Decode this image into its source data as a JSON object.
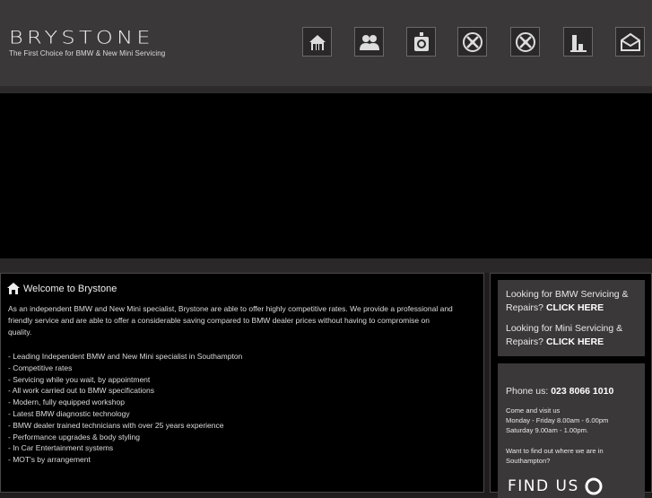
{
  "header": {
    "brand": "BRYSTONE",
    "tagline": "The First Choice for BMW & New Mini Servicing"
  },
  "nav": [
    {
      "icon": "home-icon"
    },
    {
      "icon": "people-icon"
    },
    {
      "icon": "camera-icon"
    },
    {
      "icon": "tools-icon"
    },
    {
      "icon": "tools-icon"
    },
    {
      "icon": "bar-chart-icon"
    },
    {
      "icon": "envelope-icon"
    }
  ],
  "main": {
    "welcome_title": "Welcome to Brystone",
    "intro_lines": [
      "As an independent BMW and New Mini specialist, Brystone are able to offer highly competitive rates. We provide a professional and",
      "friendly service and are able to offer a considerable saving compared to BMW dealer prices without having to compromise on",
      "quality."
    ],
    "features": [
      "- Leading Independent BMW and New Mini specialist in Southampton",
      "- Competitive rates",
      "- Servicing while you wait, by appointment",
      "- All work carried out to BMW specifications",
      "- Modern, fully equipped workshop",
      "- Latest BMW diagnostic technology",
      "- BMW dealer trained technicians with over 25 years experience",
      "- Performance upgrades & body styling",
      "- In Car Entertainment systems",
      "- MOT's by arrangement"
    ]
  },
  "sidebar": {
    "bmw_lead": "Looking for BMW Servicing &",
    "bmw_tail": "Repairs?",
    "bmw_cta": "CLICK HERE",
    "mini_lead": "Looking for Mini Servicing &",
    "mini_tail": "Repairs?",
    "mini_cta": "CLICK HERE",
    "phone_label": "Phone us:",
    "phone_number": "023 8066 1010",
    "visit_title": "Come and visit us",
    "visit_weekday": "Monday - Friday 8.00am - 6.00pm",
    "visit_saturday": "Saturday 9.00am - 1.00pm.",
    "where_line1": "Want to find out where we are in",
    "where_line2": "Southampton?",
    "find_us": "FIND US"
  }
}
